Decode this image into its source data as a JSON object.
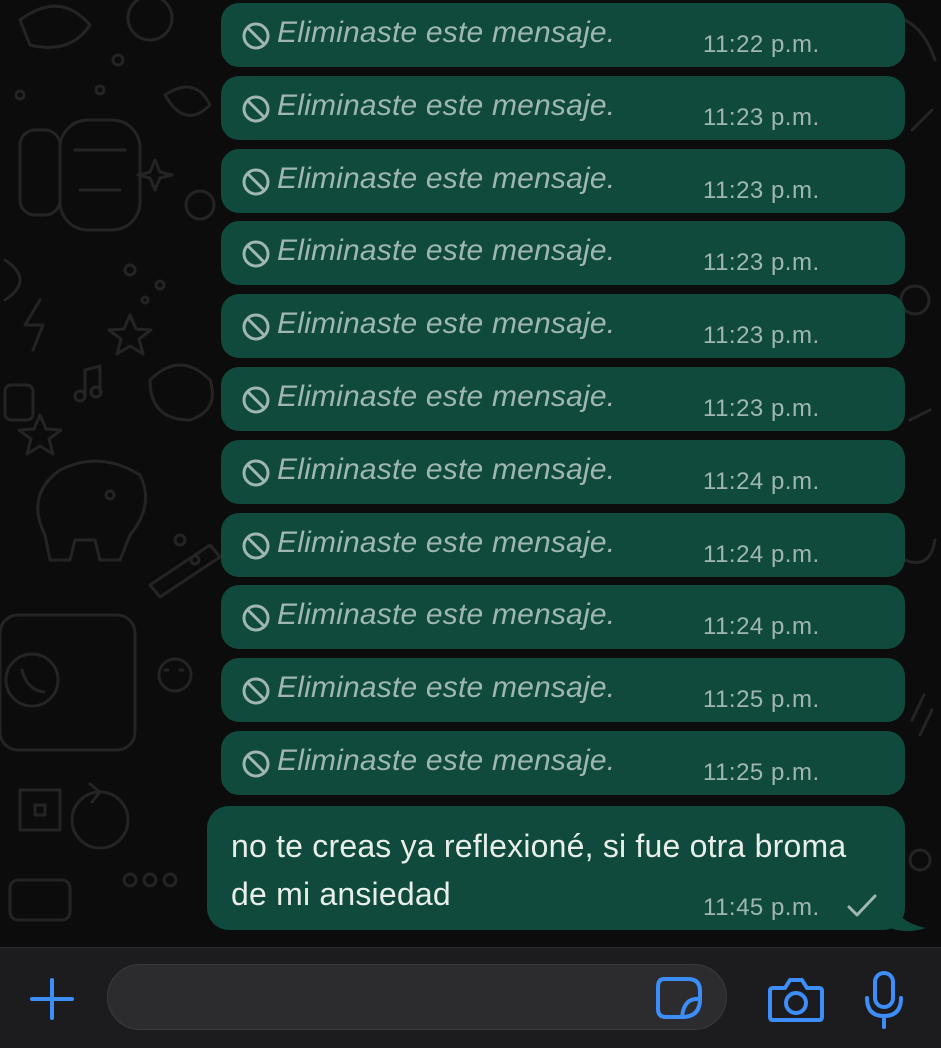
{
  "chat": {
    "deleted_messages": [
      {
        "text": "Eliminaste este mensaje.",
        "time": "11:22 p.m."
      },
      {
        "text": "Eliminaste este mensaje.",
        "time": "11:23 p.m."
      },
      {
        "text": "Eliminaste este mensaje.",
        "time": "11:23 p.m."
      },
      {
        "text": "Eliminaste este mensaje.",
        "time": "11:23 p.m."
      },
      {
        "text": "Eliminaste este mensaje.",
        "time": "11:23 p.m."
      },
      {
        "text": "Eliminaste este mensaje.",
        "time": "11:23 p.m."
      },
      {
        "text": "Eliminaste este mensaje.",
        "time": "11:24 p.m."
      },
      {
        "text": "Eliminaste este mensaje.",
        "time": "11:24 p.m."
      },
      {
        "text": "Eliminaste este mensaje.",
        "time": "11:24 p.m."
      },
      {
        "text": "Eliminaste este mensaje.",
        "time": "11:25 p.m."
      },
      {
        "text": "Eliminaste este mensaje.",
        "time": "11:25 p.m."
      }
    ],
    "last_message": {
      "text": "no te creas ya reflexioné, si fue otra broma de mi ansiedad",
      "time": "11:45 p.m.",
      "status": "sent",
      "status_icon": "single-check-icon"
    }
  },
  "input_bar": {
    "message_value": "",
    "icons": [
      "plus-icon",
      "sticker-icon",
      "camera-icon",
      "microphone-icon"
    ],
    "accent_color": "#3d8ef8"
  },
  "colors": {
    "background": "#0b0c0b",
    "outgoing_bubble": "#0f4a3d",
    "deleted_text": "#9fb7b0",
    "message_text": "#e8eee9"
  }
}
